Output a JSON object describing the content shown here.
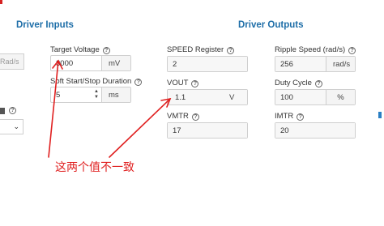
{
  "driver_inputs": {
    "title": "Driver Inputs",
    "partial_left_unit": "Rad/s",
    "target_voltage": {
      "label": "Target Voltage",
      "value": "3000",
      "unit": "mV"
    },
    "soft_start": {
      "label": "Soft Start/Stop Duration",
      "value": "5",
      "unit": "ms"
    }
  },
  "driver_outputs": {
    "title": "Driver Outputs",
    "speed_register": {
      "label": "SPEED Register",
      "value": "2"
    },
    "ripple_speed": {
      "label": "Ripple Speed (rad/s)",
      "value": "256",
      "unit": "rad/s"
    },
    "vout": {
      "label": "VOUT",
      "value": "1.1",
      "unit": "V"
    },
    "duty_cycle": {
      "label": "Duty Cycle",
      "value": "100",
      "unit": "%"
    },
    "vmtr": {
      "label": "VMTR",
      "value": "17"
    },
    "imtr": {
      "label": "IMTR",
      "value": "20"
    }
  },
  "annotation": {
    "text": "这两个值不一致",
    "color": "#e02020"
  },
  "icons": {
    "help": "help-circle-icon",
    "chevron": "chevron-down-icon"
  }
}
